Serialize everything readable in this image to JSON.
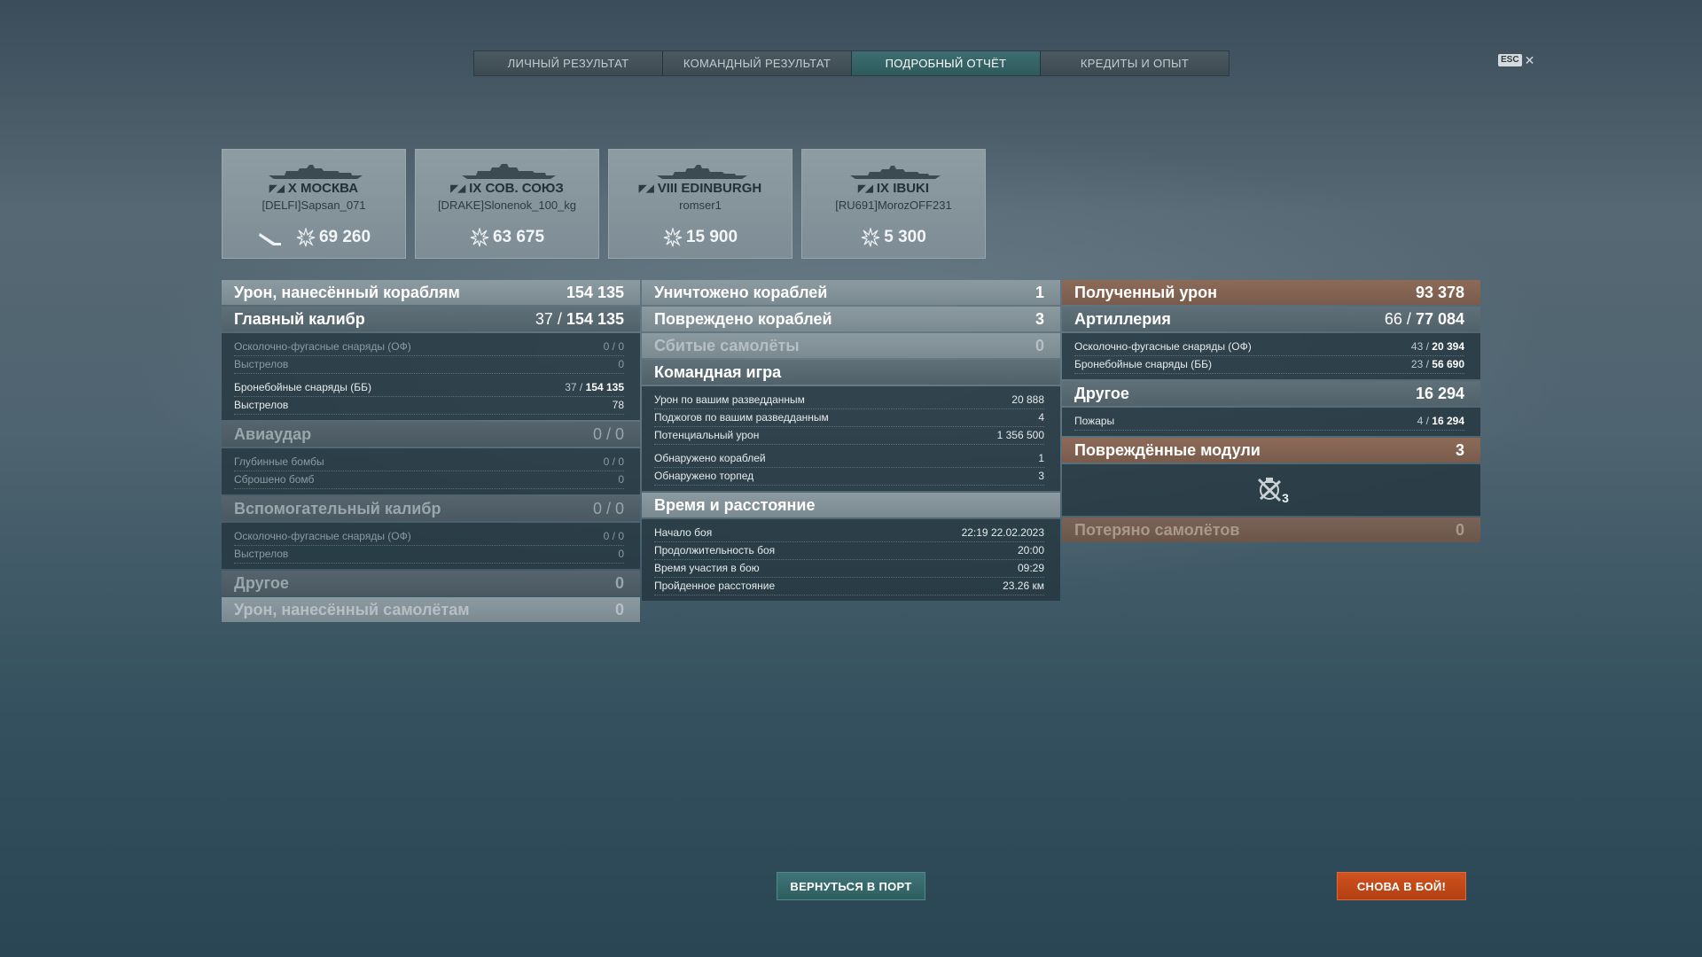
{
  "tabs": [
    {
      "label": "ЛИЧНЫЙ РЕЗУЛЬТАТ"
    },
    {
      "label": "КОМАНДНЫЙ РЕЗУЛЬТАТ"
    },
    {
      "label": "ПОДРОБНЫЙ ОТЧЁТ"
    },
    {
      "label": "КРЕДИТЫ И ОПЫТ"
    }
  ],
  "esc": {
    "badge": "ESC",
    "close": "✕"
  },
  "ships": [
    {
      "tier_name": "X МОСКВА",
      "player": "[DELFI]Sapsan_071",
      "damage": "69 260",
      "icon": "ship-silhouette-icon"
    },
    {
      "tier_name": "IX СОВ. СОЮЗ",
      "player": "[DRAKE]Slonenok_100_kg",
      "damage": "63 675",
      "icon": "ship-silhouette-icon"
    },
    {
      "tier_name": "VIII EDINBURGH",
      "player": "romser1",
      "damage": "15 900",
      "icon": "ship-silhouette-icon"
    },
    {
      "tier_name": "IX IBUKI",
      "player": "[RU691]MorozOFF231",
      "damage": "5 300",
      "icon": "ship-silhouette-icon"
    }
  ],
  "damage_dealt": {
    "title": "Урон, нанесённый кораблям",
    "value": "154 135",
    "main_battery": {
      "title": "Главный калибр",
      "hits": "37",
      "total": "154 135"
    },
    "he_label": "Осколочно-фугасные снаряды (ОФ)",
    "he_hits": "0",
    "he_value": "0",
    "he_shots_label": "Выстрелов",
    "he_shots": "0",
    "ap_label": "Бронебойные снаряды (ББ)",
    "ap_hits": "37",
    "ap_value": "154 135",
    "ap_shots_label": "Выстрелов",
    "ap_shots": "78",
    "airstrike": {
      "title": "Авиаудар",
      "hits": "0",
      "total": "0"
    },
    "depth_label": "Глубинные бомбы",
    "depth_hits": "0",
    "depth_value": "0",
    "bombs_label": "Сброшено бомб",
    "bombs": "0",
    "secondary": {
      "title": "Вспомогательный калибр",
      "hits": "0",
      "total": "0"
    },
    "sec_he_label": "Осколочно-фугасные снаряды (ОФ)",
    "sec_he_hits": "0",
    "sec_he_value": "0",
    "sec_shots_label": "Выстрелов",
    "sec_shots": "0",
    "other": {
      "title": "Другое",
      "value": "0"
    },
    "planes": {
      "title": "Урон, нанесённый самолётам",
      "value": "0"
    }
  },
  "middle": {
    "destroyed": {
      "label": "Уничтожено кораблей",
      "value": "1"
    },
    "damaged": {
      "label": "Повреждено кораблей",
      "value": "3"
    },
    "planes_shot": {
      "label": "Сбитые самолёты",
      "value": "0"
    },
    "team": {
      "title": "Командная игра",
      "rows": [
        {
          "label": "Урон по вашим разведданным",
          "value": "20 888"
        },
        {
          "label": "Поджогов по вашим разведданным",
          "value": "4"
        },
        {
          "label": "Потенциальный урон",
          "value": "1 356 500"
        },
        {
          "label": "Обнаружено кораблей",
          "value": "1"
        },
        {
          "label": "Обнаружено торпед",
          "value": "3"
        }
      ]
    },
    "time": {
      "title": "Время и расстояние",
      "rows": [
        {
          "label": "Начало боя",
          "value": "22:19  22.02.2023"
        },
        {
          "label": "Продолжительность боя",
          "value": "20:00"
        },
        {
          "label": "Время участия в бою",
          "value": "09:29"
        },
        {
          "label": "Пройденное расстояние",
          "value": "23.26 км"
        }
      ]
    }
  },
  "received": {
    "title": "Полученный урон",
    "value": "93 378",
    "artillery": {
      "title": "Артиллерия",
      "hits": "66",
      "total": "77 084"
    },
    "he_label": "Осколочно-фугасные снаряды (ОФ)",
    "he_hits": "43",
    "he_value": "20 394",
    "ap_label": "Бронебойные снаряды (ББ)",
    "ap_hits": "23",
    "ap_value": "56 690",
    "other": {
      "title": "Другое",
      "value": "16 294"
    },
    "fires_label": "Пожары",
    "fires_hits": "4",
    "fires_value": "16 294",
    "modules": {
      "title": "Повреждённые модули",
      "value": "3",
      "icon": "torpedo-tube-module-icon",
      "count": "3"
    },
    "planes_lost": {
      "title": "Потеряно самолётов",
      "value": "0"
    }
  },
  "buttons": {
    "port": "ВЕРНУТЬСЯ В ПОРТ",
    "battle": "СНОВА В БОЙ!"
  },
  "colors": {
    "accent_tab": "#2f5a5c",
    "battle_button": "#c44a19",
    "received_header": "#8c6a58"
  }
}
